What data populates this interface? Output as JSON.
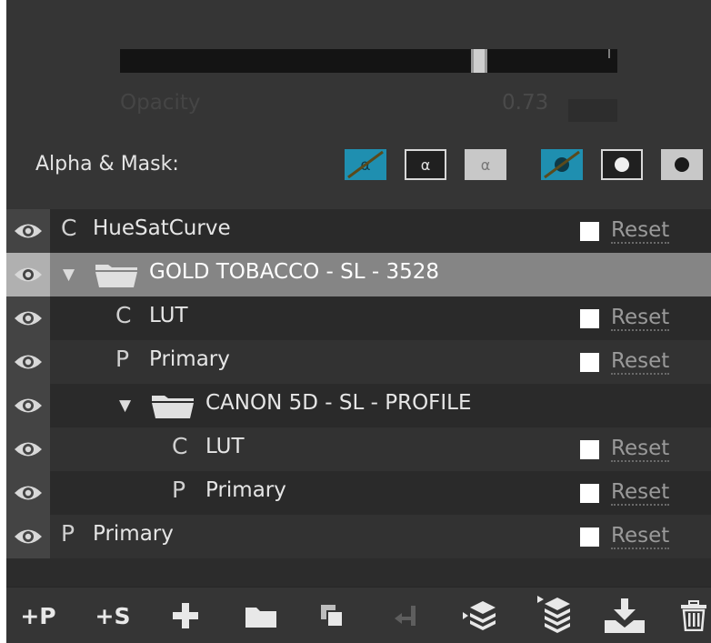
{
  "opacity": {
    "label": "Opacity",
    "value": "0.73",
    "slider_fraction": 0.73
  },
  "alpha_mask": {
    "label": "Alpha & Mask:",
    "buttons": [
      {
        "icon": "alpha-disabled-icon",
        "active": true
      },
      {
        "icon": "alpha-icon",
        "glyph": "α",
        "active": false
      },
      {
        "icon": "alpha-invert-icon",
        "glyph": "α",
        "active": false
      },
      {
        "icon": "mask-disabled-icon",
        "active": true
      },
      {
        "icon": "mask-icon",
        "active": false
      },
      {
        "icon": "mask-invert-icon",
        "active": false
      }
    ]
  },
  "layers": [
    {
      "type": "C",
      "name": "HueSatCurve",
      "indent": 0,
      "kind": "layer",
      "reset": "Reset",
      "selected": false
    },
    {
      "type": "",
      "name": "GOLD TOBACCO - SL - 3528",
      "indent": 0,
      "kind": "group",
      "reset": "",
      "selected": true
    },
    {
      "type": "C",
      "name": "LUT",
      "indent": 1,
      "kind": "layer",
      "reset": "Reset",
      "selected": false
    },
    {
      "type": "P",
      "name": "Primary",
      "indent": 1,
      "kind": "layer",
      "reset": "Reset",
      "selected": false
    },
    {
      "type": "",
      "name": "CANON 5D - SL - PROFILE",
      "indent": 1,
      "kind": "group",
      "reset": "",
      "selected": false
    },
    {
      "type": "C",
      "name": "LUT",
      "indent": 2,
      "kind": "layer",
      "reset": "Reset",
      "selected": false
    },
    {
      "type": "P",
      "name": "Primary",
      "indent": 2,
      "kind": "layer",
      "reset": "Reset",
      "selected": false
    },
    {
      "type": "P",
      "name": "Primary",
      "indent": 0,
      "kind": "layer",
      "reset": "Reset",
      "selected": false
    }
  ],
  "toolbar": {
    "add_primary": "+P",
    "add_secondary": "+S",
    "icons": [
      "add-icon",
      "folder-icon",
      "duplicate-icon",
      "merge-down-icon",
      "expand-layers-icon",
      "collapse-layers-icon",
      "import-icon",
      "trash-icon"
    ]
  },
  "colors": {
    "active_blue": "#1f8fb0",
    "selected_row": "#858585",
    "panel_bg": "#353535"
  }
}
